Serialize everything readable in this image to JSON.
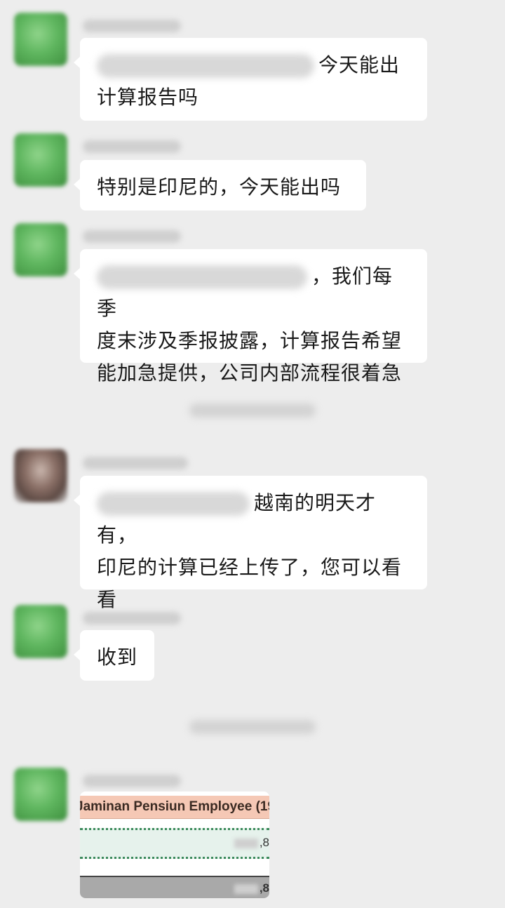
{
  "messages": [
    {
      "text": "今天能出计算报告吗",
      "line1": "今天能出",
      "line2": "计算报告吗"
    },
    {
      "text": "特别是印尼的，今天能出吗"
    },
    {
      "line1": "，我们每季",
      "line2": "度末涉及季报披露，计算报告希望",
      "line3": "能加急提供，公司内部流程很着急"
    },
    {
      "line1": "越南的明天才有，",
      "line2": "印尼的计算已经上传了，您可以看",
      "line3": "看"
    },
    {
      "text": "收到"
    }
  ],
  "attachment": {
    "header": "Jaminan Pensiun Employee (19",
    "value1": ",8",
    "value2": ",8"
  }
}
